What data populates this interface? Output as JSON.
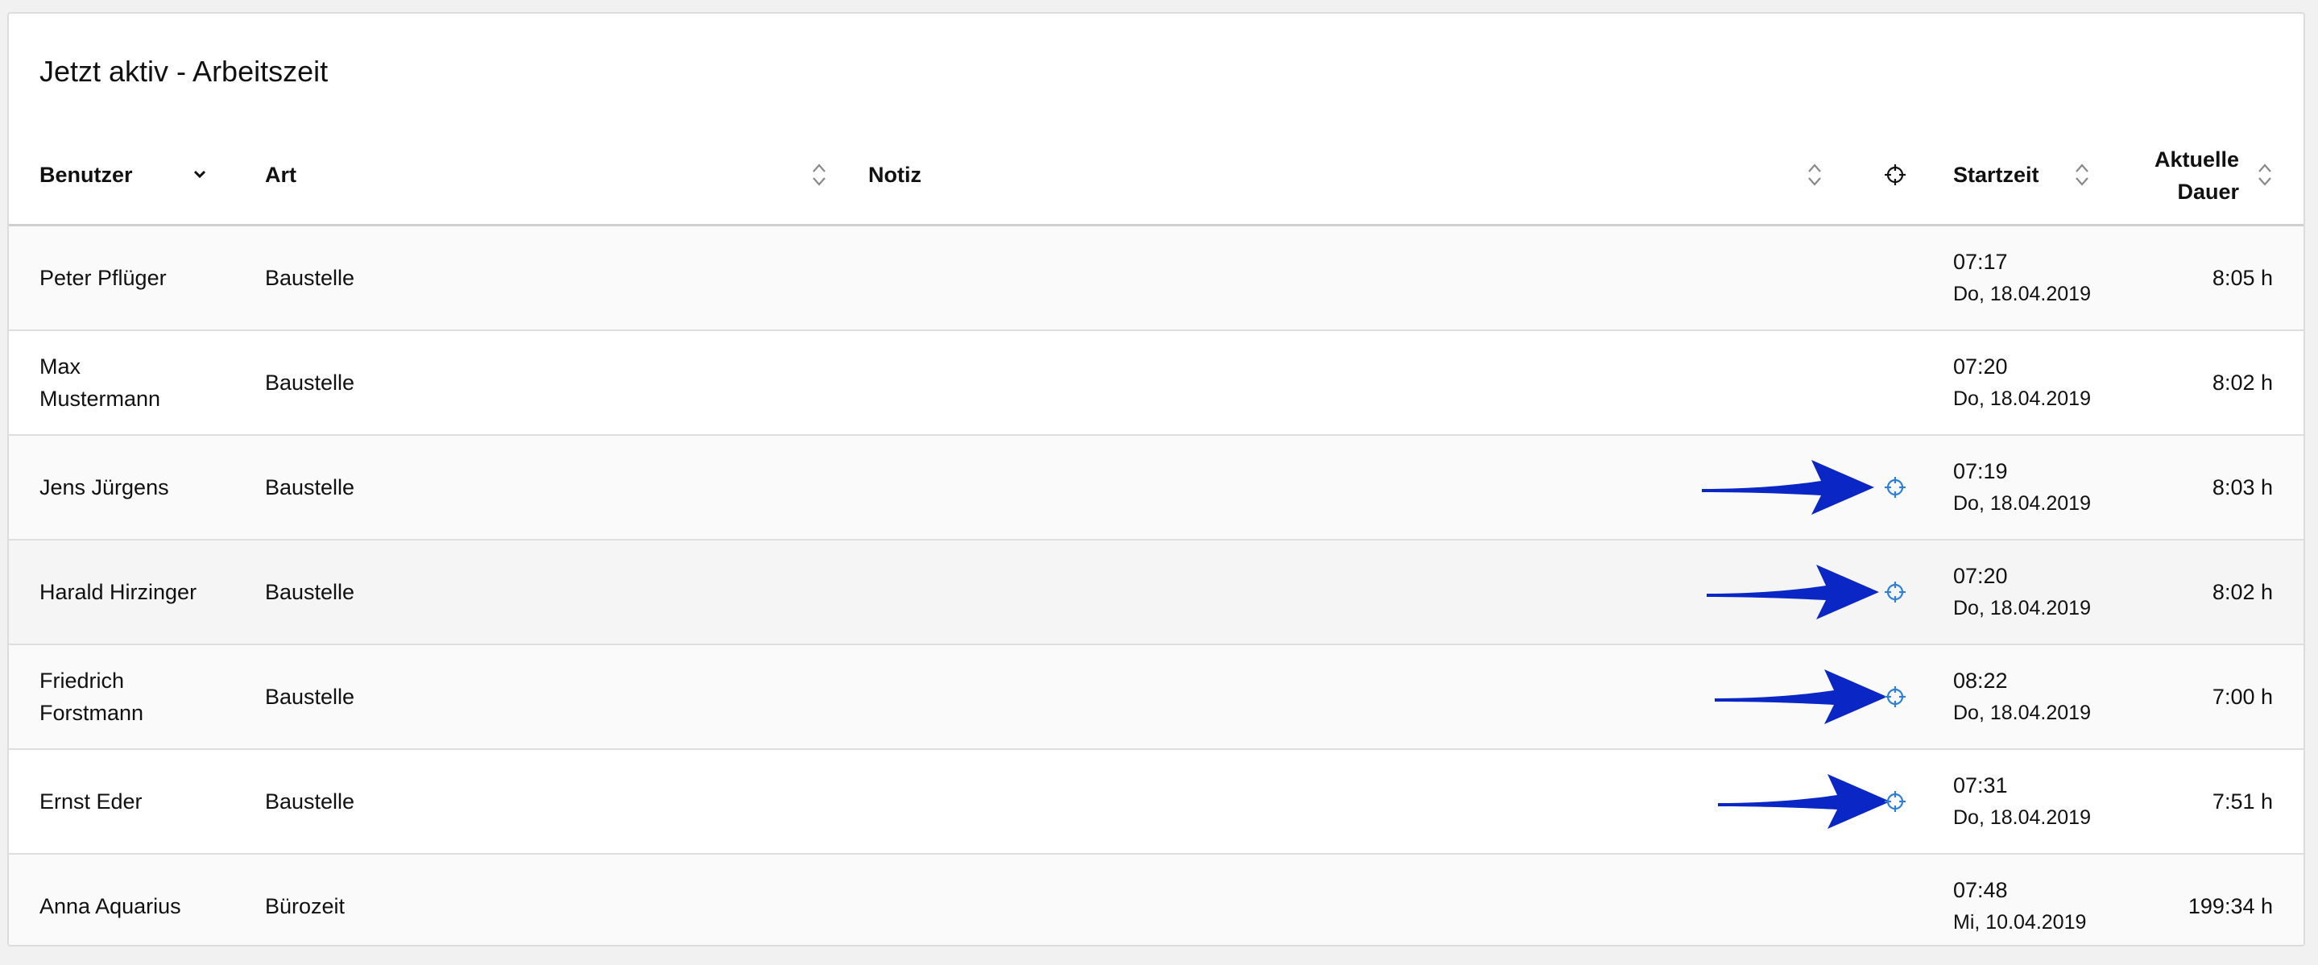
{
  "card": {
    "title": "Jetzt aktiv - Arbeitszeit"
  },
  "columns": {
    "user": "Benutzer",
    "art": "Art",
    "note": "Notiz",
    "location": "crosshair-icon",
    "start": "Startzeit",
    "duration_line1": "Aktuelle",
    "duration_line2": "Dauer"
  },
  "colors": {
    "location_icon": "#2f7fd6",
    "arrow": "#0a26c4"
  },
  "rows": [
    {
      "user": "Peter Pflüger",
      "art": "Baustelle",
      "note": "",
      "start_time": "07:17",
      "start_date": "Do, 18.04.2019",
      "duration": "8:05 h",
      "has_location": false
    },
    {
      "user": "Max Mustermann",
      "art": "Baustelle",
      "note": "",
      "start_time": "07:20",
      "start_date": "Do, 18.04.2019",
      "duration": "8:02 h",
      "has_location": false
    },
    {
      "user": "Jens Jürgens",
      "art": "Baustelle",
      "note": "",
      "start_time": "07:19",
      "start_date": "Do, 18.04.2019",
      "duration": "8:03 h",
      "has_location": true
    },
    {
      "user": "Harald Hirzinger",
      "art": "Baustelle",
      "note": "",
      "start_time": "07:20",
      "start_date": "Do, 18.04.2019",
      "duration": "8:02 h",
      "has_location": true
    },
    {
      "user": "Friedrich Forstmann",
      "art": "Baustelle",
      "note": "",
      "start_time": "08:22",
      "start_date": "Do, 18.04.2019",
      "duration": "7:00 h",
      "has_location": true
    },
    {
      "user": "Ernst Eder",
      "art": "Baustelle",
      "note": "",
      "start_time": "07:31",
      "start_date": "Do, 18.04.2019",
      "duration": "7:51 h",
      "has_location": true
    },
    {
      "user": "Anna Aquarius",
      "art": "Bürozeit",
      "note": "",
      "start_time": "07:48",
      "start_date": "Mi, 10.04.2019",
      "duration": "199:34 h",
      "has_location": false
    }
  ]
}
